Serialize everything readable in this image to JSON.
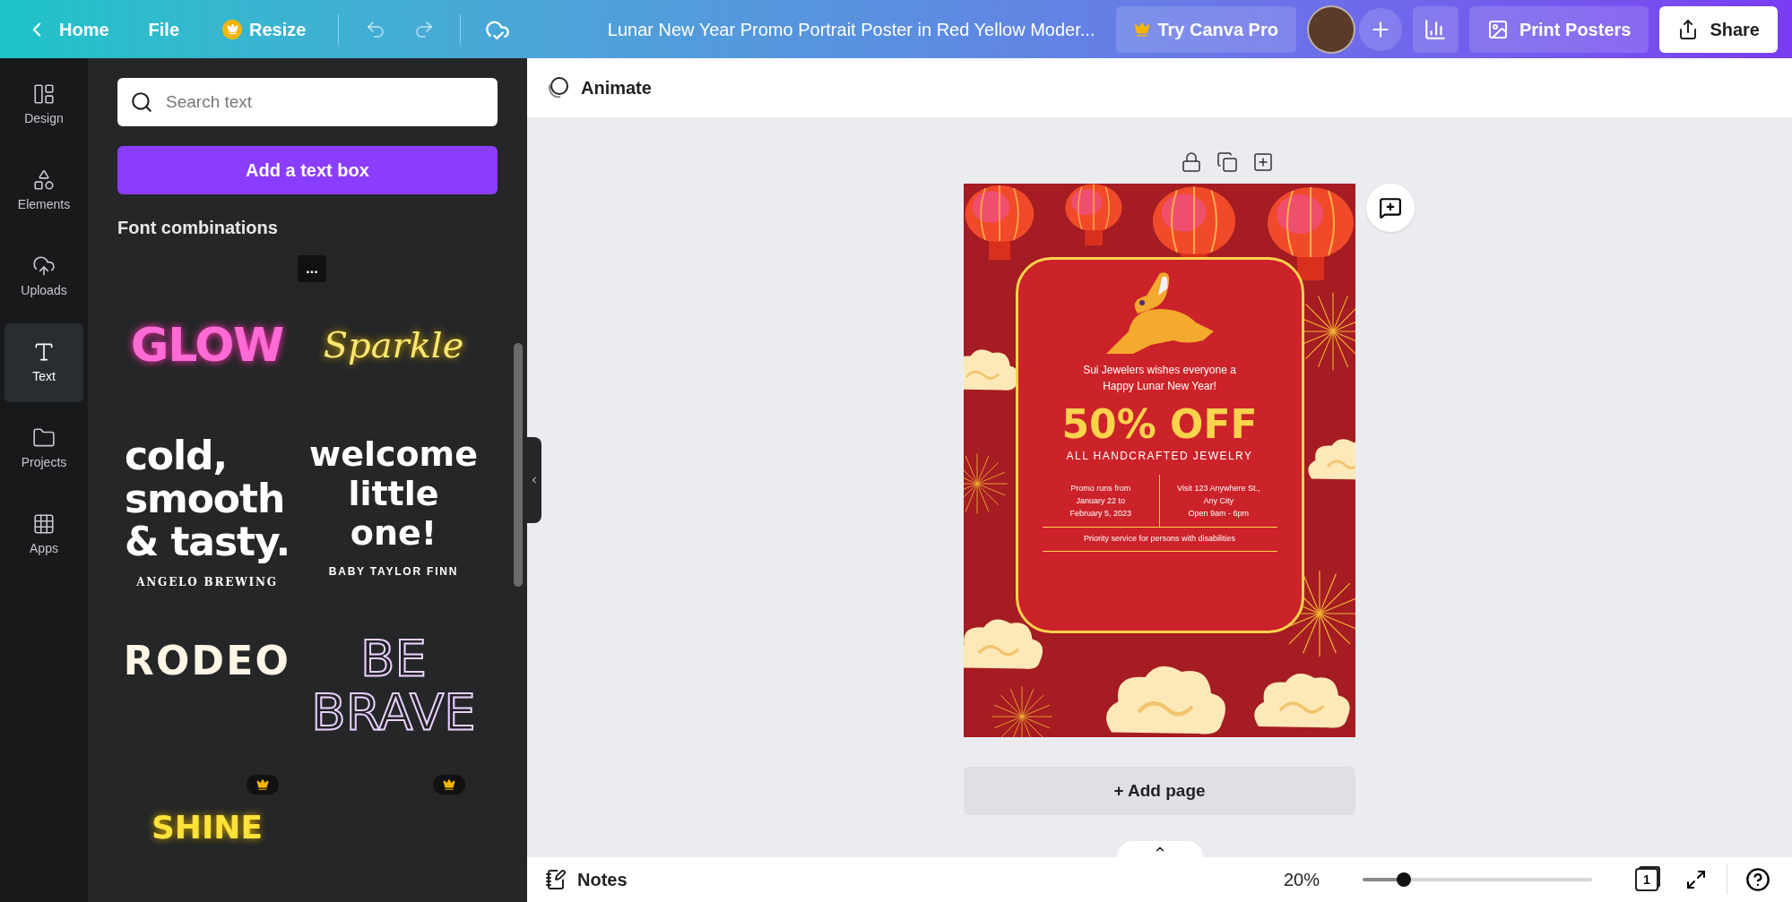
{
  "top_bar": {
    "home": "Home",
    "file": "File",
    "resize": "Resize",
    "title": "Lunar New Year Promo Portrait Poster in Red Yellow Moder...",
    "try_pro": "Try Canva Pro",
    "print": "Print Posters",
    "share": "Share"
  },
  "sidebar": {
    "items": [
      {
        "label": "Design",
        "selected": false
      },
      {
        "label": "Elements",
        "selected": false
      },
      {
        "label": "Uploads",
        "selected": false
      },
      {
        "label": "Text",
        "selected": true
      },
      {
        "label": "Projects",
        "selected": false
      },
      {
        "label": "Apps",
        "selected": false
      }
    ]
  },
  "panel": {
    "search": {
      "placeholder": "Search text"
    },
    "add_button": "Add a text box",
    "section_title": "Font combinations",
    "more": "...",
    "samples": [
      {
        "kind": "glow",
        "lines": [
          "GLOW"
        ],
        "pro": false
      },
      {
        "kind": "script",
        "lines": [
          "Sparkle"
        ],
        "pro": false
      },
      {
        "kind": "bold",
        "lines": [
          "cold,",
          "smooth",
          "& tasty."
        ],
        "caption": "ANGELO BREWING",
        "pro": false
      },
      {
        "kind": "rounded",
        "lines": [
          "welcome",
          "little one!"
        ],
        "caption": "BABY TAYLOR FINN",
        "pro": false
      },
      {
        "kind": "slab",
        "lines": [
          "RODEO"
        ],
        "pro": true
      },
      {
        "kind": "outline",
        "lines": [
          "BE",
          "BRAVE"
        ],
        "pro": true
      },
      {
        "kind": "shine",
        "lines": [
          "SHINE"
        ],
        "pro": false
      }
    ]
  },
  "toolbar": {
    "animate": "Animate"
  },
  "poster": {
    "greeting": [
      "Sui Jewelers wishes everyone a",
      "Happy Lunar New Year!"
    ],
    "headline": "50% OFF",
    "subhead": "ALL HANDCRAFTED JEWELRY",
    "left_info": [
      "Promo runs from",
      "January 22 to",
      "February 5, 2023"
    ],
    "right_info": [
      "Visit 123 Anywhere St.,",
      "Any City",
      "Open 9am - 6pm"
    ],
    "footer": "Priority service for persons with disabilities"
  },
  "add_page": "+ Add page",
  "status_bar": {
    "notes": "Notes",
    "zoom": "20%",
    "zoom_slider": {
      "level": 0.18
    },
    "page_count": "1"
  }
}
